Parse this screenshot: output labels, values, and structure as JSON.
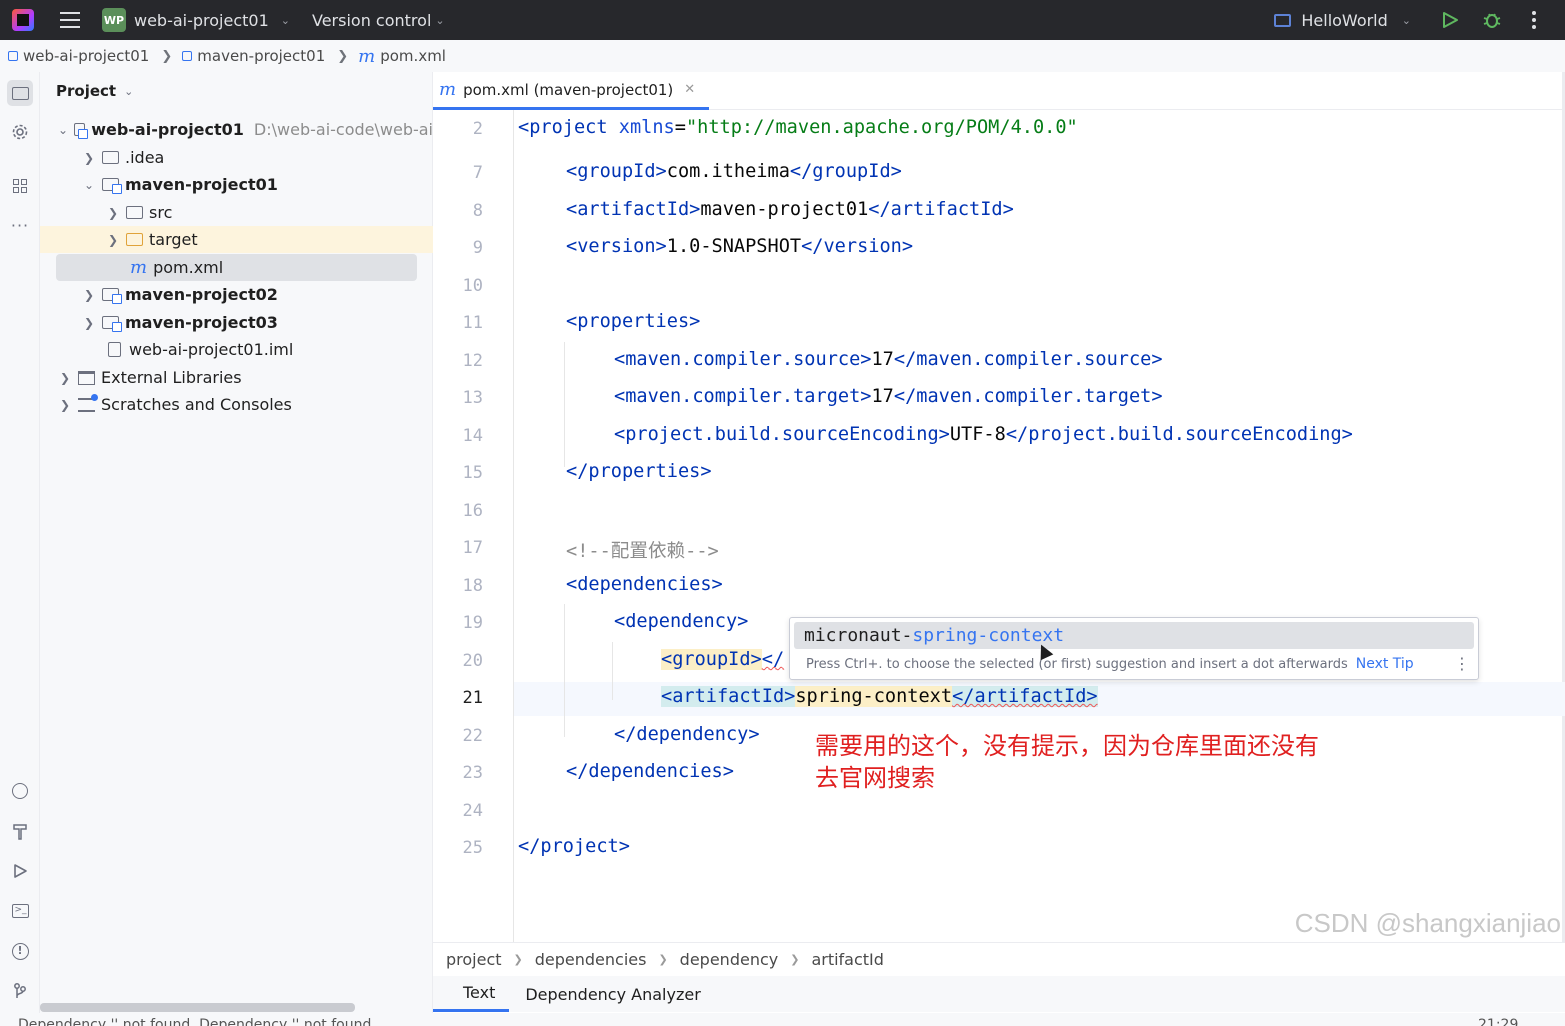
{
  "titlebar": {
    "badge": "WP",
    "project": "web-ai-project01",
    "version_control": "Version control",
    "run_config": "HelloWorld"
  },
  "breadcrumb": [
    "web-ai-project01",
    "maven-project01",
    "pom.xml"
  ],
  "project_panel": {
    "title": "Project",
    "root": "web-ai-project01",
    "root_path": "D:\\web-ai-code\\web-ai",
    "items": {
      "idea": ".idea",
      "maven1": "maven-project01",
      "src": "src",
      "target": "target",
      "pom": "pom.xml",
      "maven2": "maven-project02",
      "maven3": "maven-project03",
      "iml": "web-ai-project01.iml",
      "ext": "External Libraries",
      "scratches": "Scratches and Consoles"
    }
  },
  "editor": {
    "tab_label": "pom.xml (maven-project01)",
    "line_numbers": [
      "2",
      "7",
      "8",
      "9",
      "10",
      "11",
      "12",
      "13",
      "14",
      "15",
      "16",
      "17",
      "18",
      "19",
      "20",
      "21",
      "22",
      "23",
      "24",
      "25"
    ],
    "current_line": "21",
    "code": {
      "l2_tag": "<project",
      "l2_attr": " xmlns",
      "l2_eq": "=",
      "l2_str": "\"http://maven.apache.org/POM/4.0.0\"",
      "l7_open": "<groupId>",
      "l7_val": "com.itheima",
      "l7_close": "</groupId>",
      "l8_open": "<artifactId>",
      "l8_val": "maven-project01",
      "l8_close": "</artifactId>",
      "l9_open": "<version>",
      "l9_val": "1.0-SNAPSHOT",
      "l9_close": "</version>",
      "l11": "<properties>",
      "l12_open": "<maven.compiler.source>",
      "l12_val": "17",
      "l12_close": "</maven.compiler.source>",
      "l13_open": "<maven.compiler.target>",
      "l13_val": "17",
      "l13_close": "</maven.compiler.target>",
      "l14_open": "<project.build.sourceEncoding>",
      "l14_val": "UTF-8",
      "l14_close": "</project.build.sourceEncoding>",
      "l15": "</properties>",
      "l17": "<!--配置依赖-->",
      "l18": "<dependencies>",
      "l19": "<dependency>",
      "l20_open": "<groupId>",
      "l20_rest": "</",
      "l21_open": "<artifactId>",
      "l21_val": "spring-context",
      "l21_close": "</artifactId>",
      "l22": "</dependency>",
      "l23": "</dependencies>",
      "l25": "</project>"
    },
    "completion": {
      "prefix": "micronaut-",
      "match": "spring-context",
      "hint": "Press Ctrl+. to choose the selected (or first) suggestion and insert a dot afterwards",
      "next_tip": "Next Tip"
    },
    "annotation": [
      "需要用的这个，没有提示，因为仓库里面还没有",
      "去官网搜索"
    ],
    "crumbs": [
      "project",
      "dependencies",
      "dependency",
      "artifactId"
    ],
    "bottom_tabs": [
      "Text",
      "Dependency Analyzer"
    ]
  },
  "watermark": "CSDN @shangxianjiao",
  "statusbar": {
    "message": "Dependency '' not found. Dependency '' not found",
    "time": "21:29"
  },
  "colors": {
    "accent": "#3574f0",
    "tag": "#0033b3",
    "string": "#067d17",
    "annotation": "#e02020"
  }
}
